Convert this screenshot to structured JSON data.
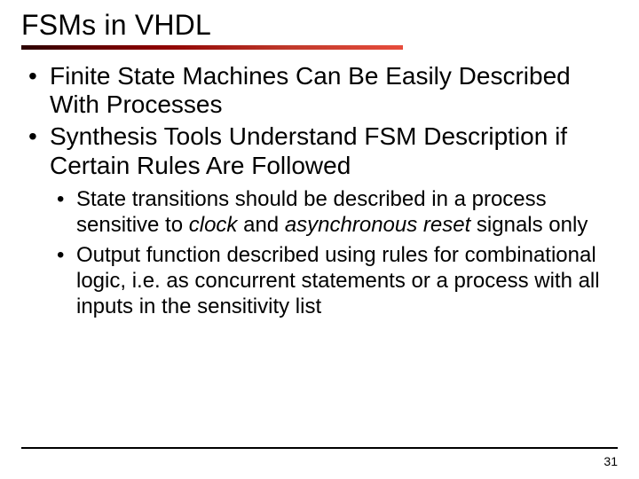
{
  "title": "FSMs in VHDL",
  "bullets": {
    "l1a": "Finite State Machines Can Be Easily Described With Processes",
    "l1b": "Synthesis Tools Understand FSM Description if Certain Rules Are Followed",
    "l2a_pre": "State transitions should be described in a process sensitive to ",
    "l2a_clock": "clock",
    "l2a_and": " and ",
    "l2a_reset": "asynchronous reset",
    "l2a_post": " signals only",
    "l2b": "Output function described using rules for combinational logic, i.e. as concurrent statements or a process with all inputs in the sensitivity list"
  },
  "page_number": "31"
}
